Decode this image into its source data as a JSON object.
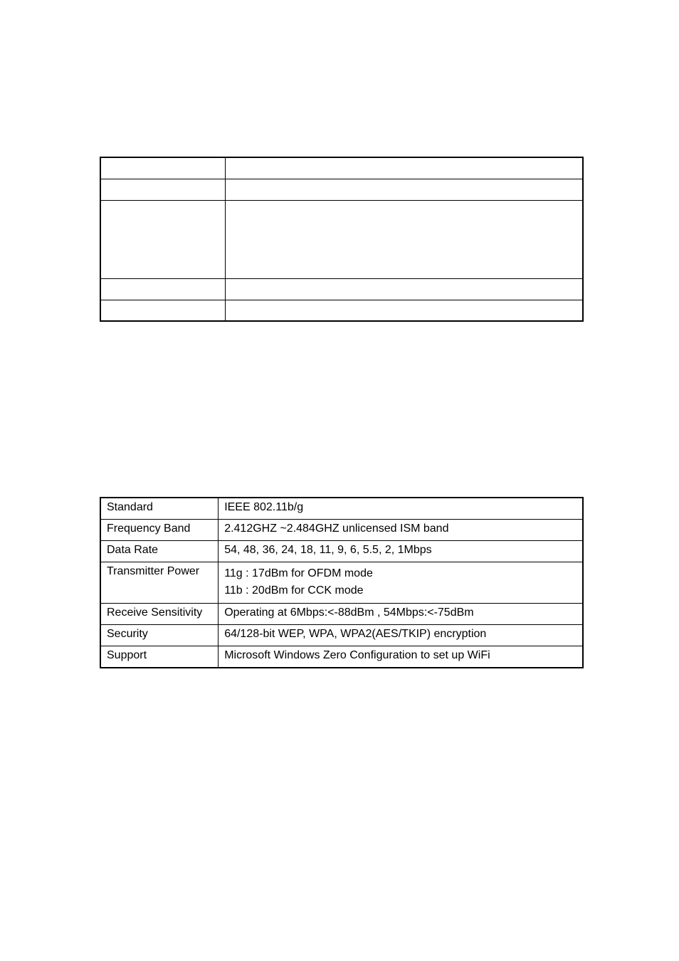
{
  "tables": {
    "top": {
      "rows": [
        {
          "left": "",
          "right": ""
        },
        {
          "left": "",
          "right": ""
        },
        {
          "left": "",
          "right": "",
          "tall": true
        },
        {
          "left": "",
          "right": ""
        },
        {
          "left": "",
          "right": ""
        }
      ]
    },
    "bottom": {
      "rows": [
        {
          "left": "Standard",
          "right": "IEEE 802.11b/g"
        },
        {
          "left": "Frequency Band",
          "right": "2.412GHZ ~2.484GHZ unlicensed ISM band"
        },
        {
          "left": "Data Rate",
          "right": "54, 48, 36, 24, 18, 11, 9, 6, 5.5, 2, 1Mbps"
        },
        {
          "left": "Transmitter Power",
          "right_lines": [
            "11g : 17dBm for OFDM mode",
            "11b : 20dBm for CCK mode"
          ]
        },
        {
          "left": "Receive Sensitivity",
          "right": "Operating at 6Mbps:<-88dBm , 54Mbps:<-75dBm"
        },
        {
          "left": "Security",
          "right": "64/128-bit WEP, WPA, WPA2(AES/TKIP) encryption"
        },
        {
          "left": "Support",
          "right": "Microsoft Windows Zero Configuration to set up WiFi"
        }
      ]
    }
  }
}
